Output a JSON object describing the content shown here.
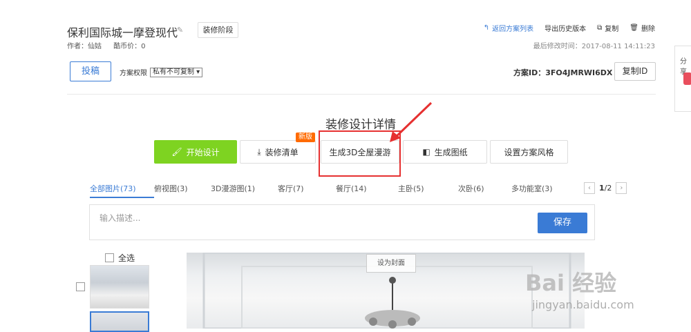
{
  "header": {
    "title": "保利国际城一摩登现代",
    "stage_button": "装修阶段",
    "author": "作者：仙姑",
    "coin_price": "酷币价：0",
    "links": {
      "back": "返回方案列表",
      "export": "导出历史版本",
      "copy": "复制",
      "delete": "删除"
    },
    "modified": "最后修改时间：2017-08-11 14:11:23"
  },
  "toolbar": {
    "post_button": "投稿",
    "permission_label": "方案权限",
    "permission_value": "私有不可复制",
    "plan_id_label": "方案ID：",
    "plan_id": "3FO4JMRWI6DX",
    "copy_id_button": "复制ID"
  },
  "section_title": "装修设计详情",
  "actions": {
    "start_design": "开始设计",
    "bill": "装修清单",
    "new_badge": "新版",
    "tour3d": "生成3D全屋漫游",
    "drawings": "生成图纸",
    "style": "设置方案风格"
  },
  "tabs": [
    {
      "label": "全部图片(73)",
      "active": true
    },
    {
      "label": "俯视图(3)"
    },
    {
      "label": "3D漫游图(1)"
    },
    {
      "label": "客厅(7)"
    },
    {
      "label": "餐厅(14)"
    },
    {
      "label": "主卧(5)"
    },
    {
      "label": "次卧(6)"
    },
    {
      "label": "多功能室(3)"
    }
  ],
  "pager": {
    "current": "1",
    "total": "/2"
  },
  "description": {
    "placeholder": "输入描述...",
    "save": "保存"
  },
  "select_all": "全选",
  "set_cover": "设为封面",
  "share_label": "分享",
  "watermark": {
    "brand": "Bai 经验",
    "url": "jingyan.baidu.com"
  },
  "colors": {
    "accent": "#3a7bd5",
    "green": "#7ed321",
    "badge": "#ff6a00",
    "highlight": "#e63030"
  }
}
